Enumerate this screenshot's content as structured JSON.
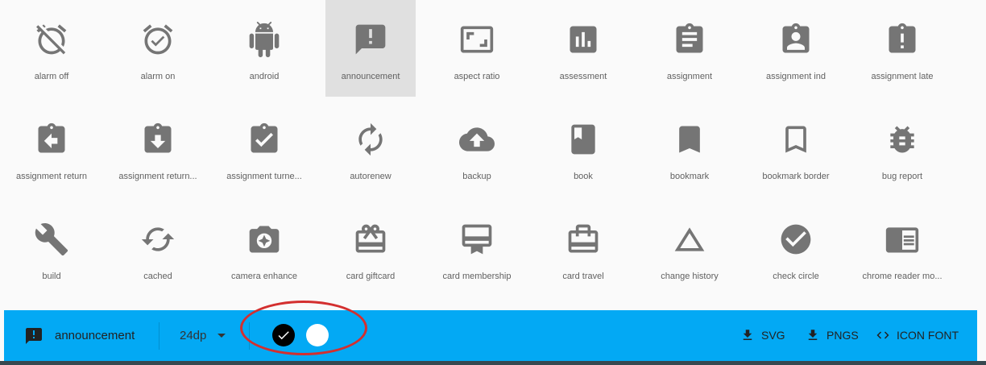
{
  "icons": [
    {
      "label": "alarm off",
      "icon": "alarm-off-icon"
    },
    {
      "label": "alarm on",
      "icon": "alarm-on-icon"
    },
    {
      "label": "android",
      "icon": "android-icon"
    },
    {
      "label": "announcement",
      "icon": "announcement-icon",
      "selected": true
    },
    {
      "label": "aspect ratio",
      "icon": "aspect-ratio-icon"
    },
    {
      "label": "assessment",
      "icon": "assessment-icon"
    },
    {
      "label": "assignment",
      "icon": "assignment-icon"
    },
    {
      "label": "assignment ind",
      "icon": "assignment-ind-icon"
    },
    {
      "label": "assignment late",
      "icon": "assignment-late-icon"
    },
    {
      "label": "assignment return",
      "icon": "assignment-return-icon"
    },
    {
      "label": "assignment return...",
      "icon": "assignment-returned-icon"
    },
    {
      "label": "assignment turne...",
      "icon": "assignment-turned-in-icon"
    },
    {
      "label": "autorenew",
      "icon": "autorenew-icon"
    },
    {
      "label": "backup",
      "icon": "backup-icon"
    },
    {
      "label": "book",
      "icon": "book-icon"
    },
    {
      "label": "bookmark",
      "icon": "bookmark-icon"
    },
    {
      "label": "bookmark border",
      "icon": "bookmark-border-icon"
    },
    {
      "label": "bug report",
      "icon": "bug-report-icon"
    },
    {
      "label": "build",
      "icon": "build-icon"
    },
    {
      "label": "cached",
      "icon": "cached-icon"
    },
    {
      "label": "camera enhance",
      "icon": "camera-enhance-icon"
    },
    {
      "label": "card giftcard",
      "icon": "card-giftcard-icon"
    },
    {
      "label": "card membership",
      "icon": "card-membership-icon"
    },
    {
      "label": "card travel",
      "icon": "card-travel-icon"
    },
    {
      "label": "change history",
      "icon": "change-history-icon"
    },
    {
      "label": "check circle",
      "icon": "check-circle-icon"
    },
    {
      "label": "chrome reader mo...",
      "icon": "chrome-reader-mode-icon"
    }
  ],
  "toolbar": {
    "selected_name": "announcement",
    "size": "24dp",
    "svg_label": "SVG",
    "pngs_label": "PNGS",
    "iconfont_label": "ICON FONT"
  },
  "colors": {
    "bar": "#03a9f4",
    "icon": "#757575",
    "selected_tile": "#e0e0e0",
    "annotation": "#d32f2f"
  }
}
